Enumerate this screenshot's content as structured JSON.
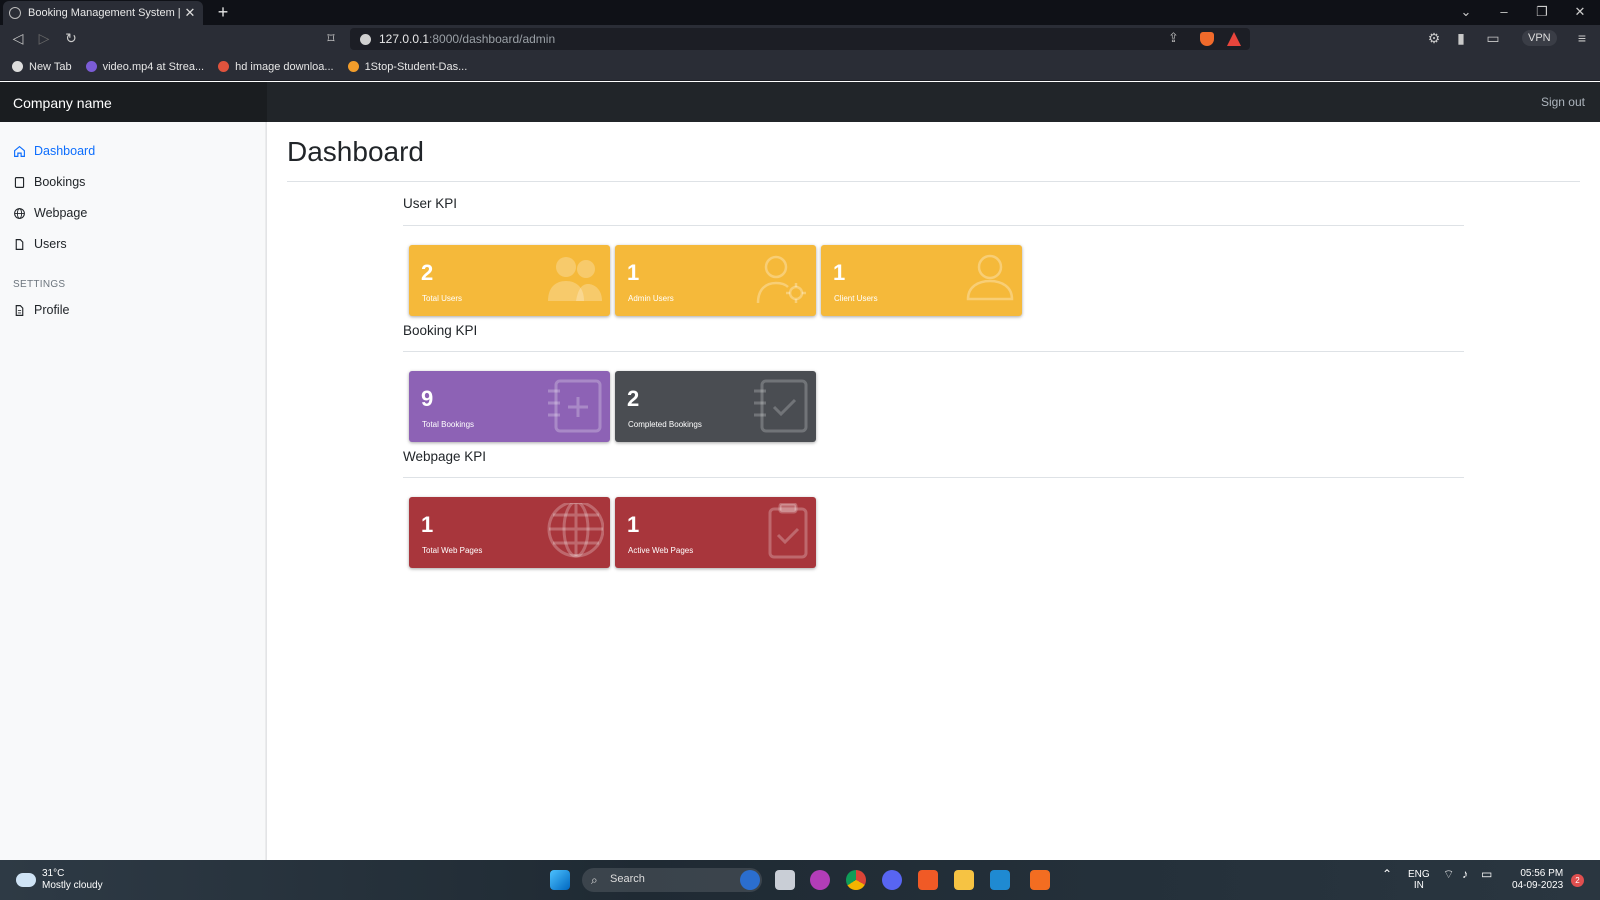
{
  "browser": {
    "tab_title": "Booking Management System | L",
    "url_host": "127.0.0.1",
    "url_path": ":8000/dashboard/admin",
    "vpn_label": "VPN",
    "bookmarks": [
      {
        "label": "New Tab",
        "color": "#dddddd"
      },
      {
        "label": "video.mp4 at Strea...",
        "color": "#7b5cd6"
      },
      {
        "label": "hd image downloa...",
        "color": "#e0533d"
      },
      {
        "label": "1Stop-Student-Das...",
        "color": "#f29d2b"
      }
    ]
  },
  "header": {
    "brand": "Company name",
    "signout": "Sign out"
  },
  "sidebar": {
    "items": [
      {
        "label": "Dashboard",
        "icon": "home-icon",
        "active": true
      },
      {
        "label": "Bookings",
        "icon": "bookmark-icon"
      },
      {
        "label": "Webpage",
        "icon": "globe-icon"
      },
      {
        "label": "Users",
        "icon": "file-icon"
      }
    ],
    "settings_heading": "SETTINGS",
    "settings_items": [
      {
        "label": "Profile",
        "icon": "file-text-icon"
      }
    ]
  },
  "main": {
    "title": "Dashboard",
    "sections": [
      {
        "title": "User KPI",
        "cards": [
          {
            "value": "2",
            "label": "Total Users",
            "color": "#f5b93a",
            "icon": "users-icon"
          },
          {
            "value": "1",
            "label": "Admin Users",
            "color": "#f5b93a",
            "icon": "user-cog-icon"
          },
          {
            "value": "1",
            "label": "Client Users",
            "color": "#f5b93a",
            "icon": "user-icon"
          }
        ]
      },
      {
        "title": "Booking KPI",
        "cards": [
          {
            "value": "9",
            "label": "Total Bookings",
            "color": "#8d62b5",
            "icon": "notebook-plus-icon"
          },
          {
            "value": "2",
            "label": "Completed Bookings",
            "color": "#4a4d52",
            "icon": "notebook-check-icon"
          }
        ]
      },
      {
        "title": "Webpage KPI",
        "cards": [
          {
            "value": "1",
            "label": "Total Web Pages",
            "color": "#a8363c",
            "icon": "globe-icon"
          },
          {
            "value": "1",
            "label": "Active Web Pages",
            "color": "#a8363c",
            "icon": "clipboard-check-icon"
          }
        ]
      }
    ]
  },
  "taskbar": {
    "temperature": "31°C",
    "weather": "Mostly cloudy",
    "search_placeholder": "Search",
    "language": "ENG",
    "region": "IN",
    "time": "05:56 PM",
    "date": "04-09-2023",
    "notifications": "2"
  }
}
